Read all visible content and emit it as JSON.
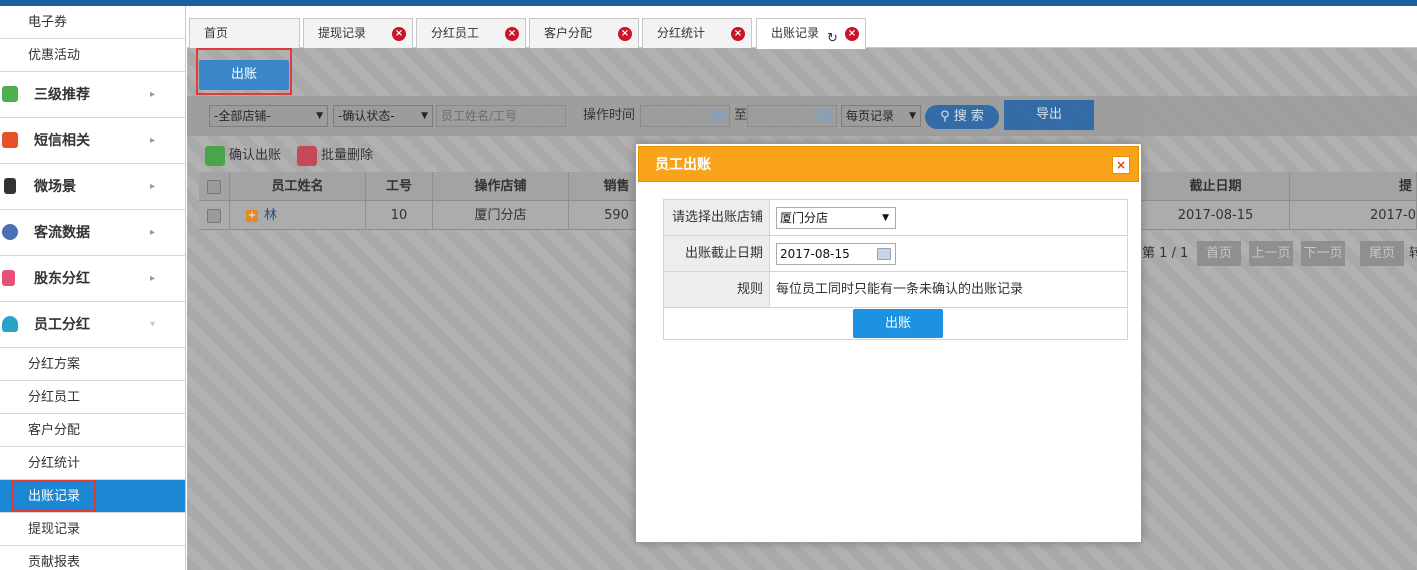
{
  "sidebar": {
    "top_items": [
      "电子券",
      "优惠活动"
    ],
    "groups": [
      {
        "label": "三级推荐",
        "icon": "layers-icon",
        "color": "#4caf50"
      },
      {
        "label": "短信相关",
        "icon": "phone-icon",
        "color": "#e8502a"
      },
      {
        "label": "微场景",
        "icon": "mobile-icon",
        "color": "#333333"
      },
      {
        "label": "客流数据",
        "icon": "chart-icon",
        "color": "#4a6fb5"
      },
      {
        "label": "股东分红",
        "icon": "document-icon",
        "color": "#e8507a"
      },
      {
        "label": "员工分红",
        "icon": "user-icon",
        "color": "#2aa3c9"
      }
    ],
    "sub_items": [
      "分红方案",
      "分红员工",
      "客户分配",
      "分红统计",
      "出账记录",
      "提现记录",
      "贡献报表"
    ],
    "active_item": "出账记录"
  },
  "tabs": [
    {
      "label": "首页",
      "closable": false
    },
    {
      "label": "提现记录",
      "closable": true
    },
    {
      "label": "分红员工",
      "closable": true
    },
    {
      "label": "客户分配",
      "closable": true
    },
    {
      "label": "分红统计",
      "closable": true
    },
    {
      "label": "出账记录",
      "closable": true,
      "active": true
    }
  ],
  "toolbar": {
    "chuzhang_label": "出账"
  },
  "filters": {
    "store_select": "-全部店铺-",
    "status_select": "-确认状态-",
    "employee_placeholder": "员工姓名/工号",
    "op_time_label": "操作时间",
    "to_label": "至",
    "page_size_select": "每页记录",
    "search_label": "搜 索",
    "export_label": "导出"
  },
  "actions": {
    "confirm_label": "确认出账",
    "batch_delete_label": "批量删除"
  },
  "table": {
    "columns": [
      "员工姓名",
      "工号",
      "操作店铺",
      "销售",
      "截止日期",
      "提"
    ],
    "row": {
      "name": "林",
      "id": "10",
      "store": "厦门分店",
      "sales": "590",
      "end_date": "2017-08-15",
      "op_date": "2017-0"
    }
  },
  "pager": {
    "info": "第 1 / 1",
    "first": "首页",
    "prev": "上一页",
    "next": "下一页",
    "last": "尾页",
    "jump": "转"
  },
  "modal": {
    "title": "员工出账",
    "store_label": "请选择出账店铺",
    "store_value": "厦门分店",
    "date_label": "出账截止日期",
    "date_value": "2017-08-15",
    "rule_label": "规则",
    "rule_text": "每位员工同时只能有一条未确认的出账记录",
    "submit_label": "出账"
  }
}
